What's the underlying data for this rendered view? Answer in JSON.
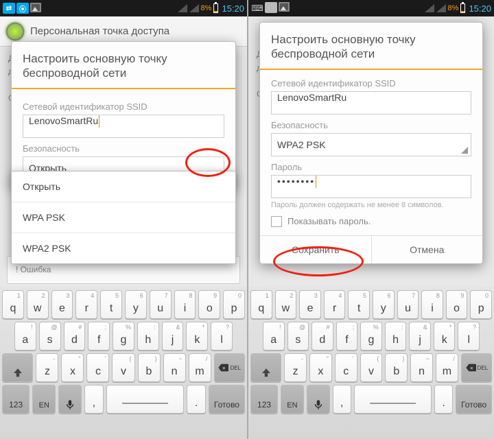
{
  "status": {
    "battery_pct": "8%",
    "time": "15:20"
  },
  "header": {
    "title": "Персональная точка доступа"
  },
  "dialog": {
    "title": "Настроить основную точку беспроводной сети",
    "ssid_label": "Сетевой идентификатор SSID",
    "ssid_value": "LenovoSmartRu",
    "security_label": "Безопасность",
    "password_label": "Пароль",
    "password_mask": "••••••••",
    "password_hint": "Пароль должен содержать не менее 8 символов.",
    "show_password": "Показывать пароль.",
    "save": "Сохранить",
    "cancel": "Отмена"
  },
  "security": {
    "open": "Открыть",
    "wpa": "WPA PSK",
    "wpa2": "WPA2 PSK"
  },
  "bg": {
    "l1": "Д",
    "l2": "д",
    "l3": "С",
    "err": "!    Ошибка"
  },
  "kb": {
    "row1": [
      {
        "main": "q",
        "alt": "1"
      },
      {
        "main": "w",
        "alt": "2"
      },
      {
        "main": "e",
        "alt": "3"
      },
      {
        "main": "r",
        "alt": "4"
      },
      {
        "main": "t",
        "alt": "5"
      },
      {
        "main": "y",
        "alt": "6"
      },
      {
        "main": "u",
        "alt": "7"
      },
      {
        "main": "i",
        "alt": "8"
      },
      {
        "main": "o",
        "alt": "9"
      },
      {
        "main": "p",
        "alt": "0"
      }
    ],
    "row2": [
      {
        "main": "a",
        "alt": "!"
      },
      {
        "main": "s",
        "alt": "@"
      },
      {
        "main": "d",
        "alt": "#"
      },
      {
        "main": "f",
        "alt": ";"
      },
      {
        "main": "g",
        "alt": "%"
      },
      {
        "main": "h",
        "alt": ":"
      },
      {
        "main": "j",
        "alt": "&"
      },
      {
        "main": "k",
        "alt": "*"
      },
      {
        "main": "l",
        "alt": "?"
      }
    ],
    "row3": [
      {
        "main": "z",
        "alt": "-"
      },
      {
        "main": "x",
        "alt": "\""
      },
      {
        "main": "c",
        "alt": "'"
      },
      {
        "main": "v",
        "alt": "("
      },
      {
        "main": "b",
        "alt": ")"
      },
      {
        "main": "n",
        "alt": "~"
      },
      {
        "main": "m",
        "alt": "/"
      }
    ],
    "del": "DEL",
    "num": "123",
    "lang": "EN",
    "comma": ",",
    "period": ".",
    "done": "Готово"
  }
}
